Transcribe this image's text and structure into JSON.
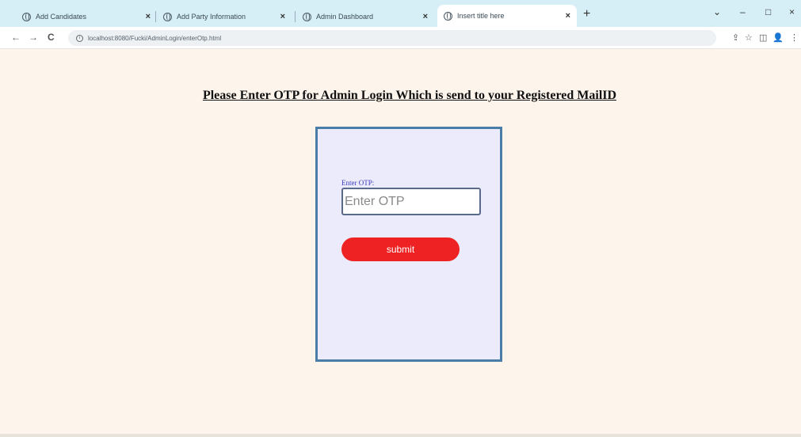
{
  "browser": {
    "tabs": [
      {
        "title": "Add Candidates",
        "close": "×"
      },
      {
        "title": "Add Party Information",
        "close": "×"
      },
      {
        "title": "Admin Dashboard",
        "close": "×"
      },
      {
        "title": "Insert title here",
        "close": "×"
      }
    ],
    "new_tab": "+",
    "window_controls": {
      "dropdown": "⌄",
      "minimize": "–",
      "maximize": "□",
      "close": "×"
    },
    "nav": {
      "back": "←",
      "forward": "→",
      "reload": "C"
    },
    "url": "localhost:8080/Fucki/AdminLogin/enterOtp.html",
    "toolbar_icons": {
      "share": "⇪",
      "star": "☆",
      "split": "◫",
      "profile": "👤",
      "menu": "⋮"
    }
  },
  "page": {
    "heading": "Please Enter OTP for Admin Login Which is send to your Registered MailID",
    "form": {
      "label": "Enter OTP:",
      "input_placeholder": "Enter OTP",
      "input_value": "",
      "submit_label": "submit"
    }
  },
  "colors": {
    "page_background": "#fdf5ec",
    "card_background": "#ebebfb",
    "card_border": "#4a7ea8",
    "submit_button": "#ee2222",
    "label_text": "#3a3ac0"
  }
}
